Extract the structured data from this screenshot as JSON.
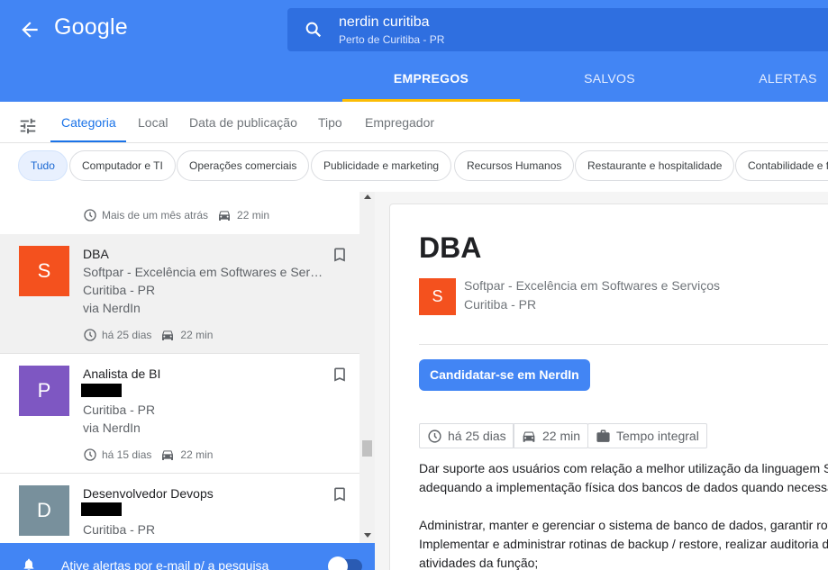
{
  "header": {
    "logo": "Google",
    "search_query": "nerdin curitiba",
    "search_location": "Perto de Curitiba - PR",
    "tabs": [
      {
        "label": "EMPREGOS"
      },
      {
        "label": "SALVOS"
      },
      {
        "label": "ALERTAS"
      }
    ]
  },
  "filters": {
    "tabs": [
      {
        "label": "Categoria"
      },
      {
        "label": "Local"
      },
      {
        "label": "Data de publicação"
      },
      {
        "label": "Tipo"
      },
      {
        "label": "Empregador"
      }
    ],
    "chips": [
      {
        "label": "Tudo"
      },
      {
        "label": "Computador e TI"
      },
      {
        "label": "Operações comerciais"
      },
      {
        "label": "Publicidade e marketing"
      },
      {
        "label": "Recursos Humanos"
      },
      {
        "label": "Restaurante e hospitalidade"
      },
      {
        "label": "Contabilidade e f"
      }
    ]
  },
  "list": {
    "partial_item": {
      "age": "Mais de um mês atrás",
      "commute": "22 min"
    },
    "jobs": [
      {
        "letter": "S",
        "title": "DBA",
        "company": "Softpar - Excelência em Softwares e Ser…",
        "location": "Curitiba - PR",
        "via": "via NerdIn",
        "age": "há 25 dias",
        "commute": "22 min",
        "color": "#f4511e"
      },
      {
        "letter": "P",
        "title": "Analista de BI",
        "location": "Curitiba - PR",
        "via": "via NerdIn",
        "age": "há 15 dias",
        "commute": "22 min",
        "color": "#7e57c2"
      },
      {
        "letter": "D",
        "title": "Desenvolvedor Devops",
        "location": "Curitiba - PR",
        "color": "#78909c"
      }
    ]
  },
  "alert_bar": {
    "text": "Ative alertas por e-mail p/ a pesquisa"
  },
  "detail": {
    "title": "DBA",
    "logo_letter": "S",
    "company": "Softpar - Excelência em Softwares e Serviços",
    "location": "Curitiba - PR",
    "apply_label": "Candidatar-se em NerdIn",
    "tags": {
      "age": "há 25 dias",
      "commute": "22 min",
      "type": "Tempo integral"
    },
    "description": [
      "Dar suporte aos usuários com relação a melhor utilização da linguagem S",
      "adequando a implementação física dos bancos de dados quando necessá",
      "",
      "Administrar, manter e gerenciar o sistema de banco de dados, garantir rot",
      "Implementar e administrar rotinas de backup / restore, realizar auditoria d",
      "atividades da função;"
    ]
  }
}
